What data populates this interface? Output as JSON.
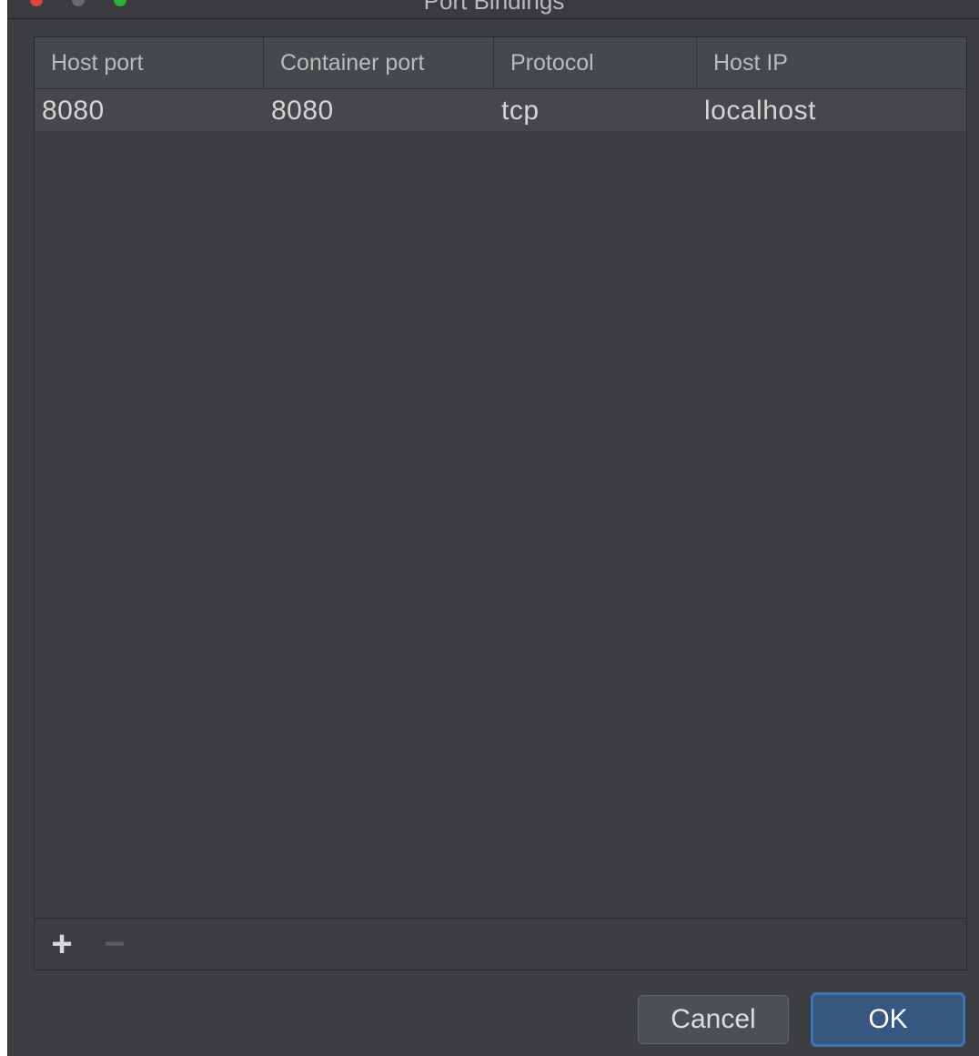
{
  "window": {
    "title": "Port Bindings"
  },
  "table": {
    "columns": [
      "Host port",
      "Container port",
      "Protocol",
      "Host IP"
    ],
    "rows": [
      [
        "8080",
        "8080",
        "tcp",
        "localhost"
      ]
    ]
  },
  "toolbar": {
    "add_label": "+",
    "remove_label": "−",
    "add_icon": "plus-icon",
    "remove_icon": "minus-icon"
  },
  "buttons": {
    "cancel_label": "Cancel",
    "ok_label": "OK"
  },
  "colors": {
    "background": "#3c3e41",
    "header": "#45494b",
    "selected_row": "#45474b",
    "ok_accent": "#365880",
    "ok_border": "#3d74b3"
  }
}
